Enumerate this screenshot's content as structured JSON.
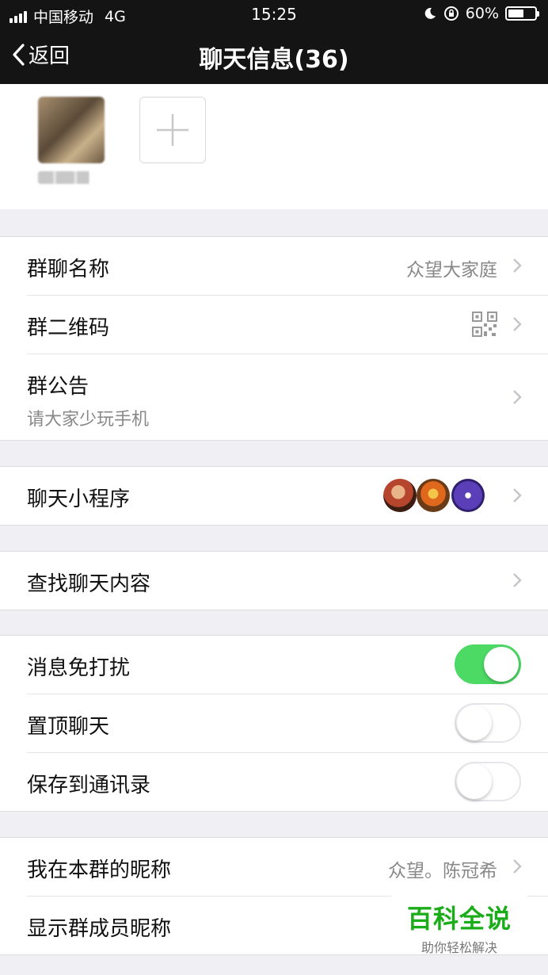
{
  "status_bar": {
    "carrier": "中国移动",
    "network": "4G",
    "time": "15:25",
    "battery": "60%",
    "battery_level": 0.6
  },
  "nav": {
    "back_label": "返回",
    "title": "聊天信息(36)"
  },
  "members": {
    "add_icon": "plus-icon",
    "avatar_icon": "member-avatar-blurred"
  },
  "settings": {
    "group_name": {
      "label": "群聊名称",
      "value": "众望大家庭"
    },
    "qr_code": {
      "label": "群二维码",
      "icon": "qr-code-icon"
    },
    "announcement": {
      "label": "群公告",
      "value": "请大家少玩手机"
    },
    "mini_programs": {
      "label": "聊天小程序",
      "icons": [
        "game-hero-icon",
        "game-character-icon",
        "app-purple-icon"
      ]
    },
    "search_history": {
      "label": "查找聊天内容"
    },
    "mute": {
      "label": "消息免打扰",
      "on": true
    },
    "sticky": {
      "label": "置顶聊天",
      "on": false
    },
    "save_contacts": {
      "label": "保存到通讯录",
      "on": false
    },
    "my_nickname": {
      "label": "我在本群的昵称",
      "value": "众望。陈冠希"
    },
    "show_nicknames": {
      "label": "显示群成员昵称"
    }
  },
  "colors": {
    "toggle_on": "#4cd964",
    "nav_bg": "#141414",
    "page_bg": "#efeff4"
  },
  "watermark": {
    "title": "百科全说",
    "subtitle": "助你轻松解决"
  }
}
